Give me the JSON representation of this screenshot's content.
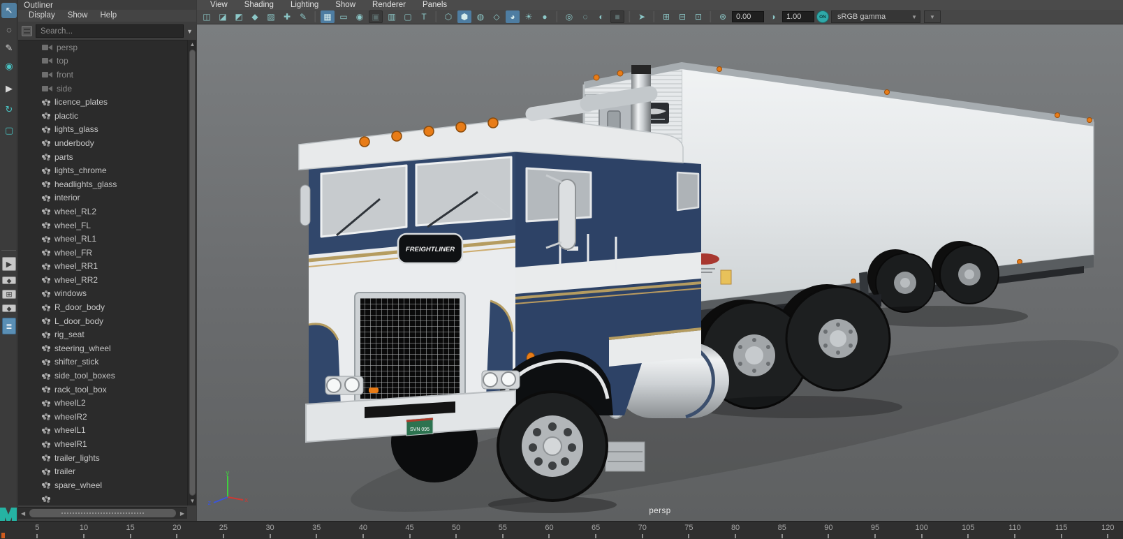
{
  "palette": {
    "panel_bg": "#3d3d3d",
    "list_bg": "#2b2b2b",
    "toolbar_bg": "#474747",
    "active_blue": "#4e7da2",
    "icon_teal": "#8cc7c7",
    "viewport_top": "#7b7e80",
    "viewport_bottom": "#5e6061",
    "truck_navy": "#31476b",
    "truck_white": "#e9ebec",
    "truck_gold": "#b59c60",
    "trailer_white": "#e8eaec",
    "marker_orange": "#e87c17",
    "maya_teal": "#25b3a3",
    "axis_x_red": "#cc3a33",
    "axis_y_green": "#3fd03f",
    "axis_z_blue": "#3a55dd"
  },
  "toolbox": {
    "tools": [
      {
        "name": "select-tool",
        "glyph": "↖",
        "active": true,
        "teal": false
      },
      {
        "name": "lasso-select-tool",
        "glyph": "◌",
        "active": false,
        "teal": false
      },
      {
        "name": "paint-select-tool",
        "glyph": "✎",
        "active": false,
        "teal": false
      },
      {
        "name": "soft-modification-tool",
        "glyph": "◉",
        "active": false,
        "teal": true
      },
      {
        "name": "move-tool",
        "glyph": "▶",
        "active": false,
        "teal": false
      },
      {
        "name": "rotate-tool",
        "glyph": "↻",
        "active": false,
        "teal": true
      },
      {
        "name": "scale-tool",
        "glyph": "▢",
        "active": false,
        "teal": true
      }
    ],
    "layouts": [
      {
        "name": "layout-single-pane",
        "glyph": "▶",
        "h": 20,
        "active": false
      },
      {
        "name": "layout-two-pane",
        "glyph": "◆",
        "h": 11,
        "active": false
      },
      {
        "name": "layout-four-pane",
        "glyph": "⊞",
        "h": 13,
        "active": false
      },
      {
        "name": "layout-persp-outliner-alt",
        "glyph": "◆",
        "h": 11,
        "active": false
      },
      {
        "name": "layout-outliner-persp",
        "glyph": "≣",
        "h": 24,
        "active": true
      }
    ]
  },
  "outliner": {
    "title": "Outliner",
    "menus": [
      "Display",
      "Show",
      "Help"
    ],
    "search_placeholder": "Search...",
    "items": [
      {
        "label": "persp",
        "icon": "camera",
        "dim": true
      },
      {
        "label": "top",
        "icon": "camera",
        "dim": true
      },
      {
        "label": "front",
        "icon": "camera",
        "dim": true
      },
      {
        "label": "side",
        "icon": "camera",
        "dim": true
      },
      {
        "label": "licence_plates",
        "icon": "mesh",
        "dim": false
      },
      {
        "label": "plactic",
        "icon": "mesh",
        "dim": false
      },
      {
        "label": "lights_glass",
        "icon": "mesh",
        "dim": false
      },
      {
        "label": "underbody",
        "icon": "mesh",
        "dim": false
      },
      {
        "label": "parts",
        "icon": "mesh",
        "dim": false
      },
      {
        "label": "lights_chrome",
        "icon": "mesh",
        "dim": false
      },
      {
        "label": "headlights_glass",
        "icon": "mesh",
        "dim": false
      },
      {
        "label": "interior",
        "icon": "mesh",
        "dim": false
      },
      {
        "label": "wheel_RL2",
        "icon": "mesh",
        "dim": false
      },
      {
        "label": "wheel_FL",
        "icon": "mesh",
        "dim": false
      },
      {
        "label": "wheel_RL1",
        "icon": "mesh",
        "dim": false
      },
      {
        "label": "wheel_FR",
        "icon": "mesh",
        "dim": false
      },
      {
        "label": "wheel_RR1",
        "icon": "mesh",
        "dim": false
      },
      {
        "label": "wheel_RR2",
        "icon": "mesh",
        "dim": false
      },
      {
        "label": "windows",
        "icon": "mesh",
        "dim": false
      },
      {
        "label": "R_door_body",
        "icon": "mesh",
        "dim": false
      },
      {
        "label": "L_door_body",
        "icon": "mesh",
        "dim": false
      },
      {
        "label": "rig_seat",
        "icon": "mesh",
        "dim": false
      },
      {
        "label": "steering_wheel",
        "icon": "mesh",
        "dim": false
      },
      {
        "label": "shifter_stick",
        "icon": "mesh",
        "dim": false
      },
      {
        "label": "side_tool_boxes",
        "icon": "mesh",
        "dim": false
      },
      {
        "label": "rack_tool_box",
        "icon": "mesh",
        "dim": false
      },
      {
        "label": "wheelL2",
        "icon": "mesh",
        "dim": false
      },
      {
        "label": "wheelR2",
        "icon": "mesh",
        "dim": false
      },
      {
        "label": "wheelL1",
        "icon": "mesh",
        "dim": false
      },
      {
        "label": "wheelR1",
        "icon": "mesh",
        "dim": false
      },
      {
        "label": "trailer_lights",
        "icon": "mesh",
        "dim": false
      },
      {
        "label": "trailer",
        "icon": "mesh",
        "dim": false
      },
      {
        "label": "spare_wheel",
        "icon": "mesh",
        "dim": false
      },
      {
        "label": "",
        "icon": "mesh",
        "dim": false
      }
    ]
  },
  "viewport": {
    "menus": [
      "View",
      "Shading",
      "Lighting",
      "Show",
      "Renderer",
      "Panels"
    ],
    "toolbar": {
      "groups": [
        [
          {
            "name": "camera-icon",
            "glyph": "◫"
          },
          {
            "name": "camera-lock-icon",
            "glyph": "◪"
          },
          {
            "name": "camera-attributes-icon",
            "glyph": "◩"
          },
          {
            "name": "bookmark-icon",
            "glyph": "◆"
          },
          {
            "name": "image-plane-icon",
            "glyph": "▨"
          },
          {
            "name": "pan-zoom-icon",
            "glyph": "✚"
          },
          {
            "name": "grease-pencil-icon",
            "glyph": "✎"
          }
        ],
        [
          {
            "name": "grid-icon",
            "glyph": "▦",
            "active": true
          },
          {
            "name": "film-gate-icon",
            "glyph": "▭"
          },
          {
            "name": "resolution-gate-icon",
            "glyph": "◉"
          },
          {
            "name": "gate-mask-icon",
            "glyph": "▣",
            "dark": true
          },
          {
            "name": "field-chart-icon",
            "glyph": "▥"
          },
          {
            "name": "safe-action-icon",
            "glyph": "▢"
          },
          {
            "name": "safe-title-icon",
            "glyph": "T"
          }
        ],
        [
          {
            "name": "wireframe-icon",
            "glyph": "⬡"
          },
          {
            "name": "smooth-shade-icon",
            "glyph": "⬢",
            "active": true
          },
          {
            "name": "wireframe-on-shaded-icon",
            "glyph": "◍"
          },
          {
            "name": "default-material-icon",
            "glyph": "◇"
          },
          {
            "name": "textured-icon",
            "glyph": "◕",
            "active": true
          },
          {
            "name": "use-all-lights-icon",
            "glyph": "☀"
          },
          {
            "name": "shadows-icon",
            "glyph": "●"
          }
        ],
        [
          {
            "name": "occlusion-icon",
            "glyph": "◎"
          },
          {
            "name": "anti-alias-icon",
            "glyph": "◌"
          },
          {
            "name": "depth-of-field-icon",
            "glyph": "◐"
          },
          {
            "name": "multisample-icon",
            "glyph": "■",
            "dark": true
          }
        ],
        [
          {
            "name": "isolate-select-icon",
            "glyph": "➤"
          }
        ],
        [
          {
            "name": "snapshot-icon",
            "glyph": "⊞"
          },
          {
            "name": "pane-layout-icon",
            "glyph": "⊟"
          },
          {
            "name": "view-arrange-icon",
            "glyph": "⊡"
          }
        ]
      ],
      "exposure_icon": "⊛",
      "exposure_value": "0.00",
      "contrast_icon": "◑",
      "contrast_value": "1.00",
      "toggle_label": "ON",
      "colorspace": "sRGB gamma"
    },
    "camera_label": "persp",
    "axis_labels": {
      "x": "x",
      "y": "y",
      "z": "z"
    }
  },
  "truck": {
    "badge_text": "FREIGHTLINER",
    "license_plate": "SVN 095"
  },
  "timeline": {
    "tick_labels": [
      5,
      10,
      15,
      20,
      25,
      30,
      35,
      40,
      45,
      50,
      55,
      60,
      65,
      70,
      75,
      80,
      85,
      90,
      95,
      100,
      105,
      110,
      115,
      120
    ]
  }
}
